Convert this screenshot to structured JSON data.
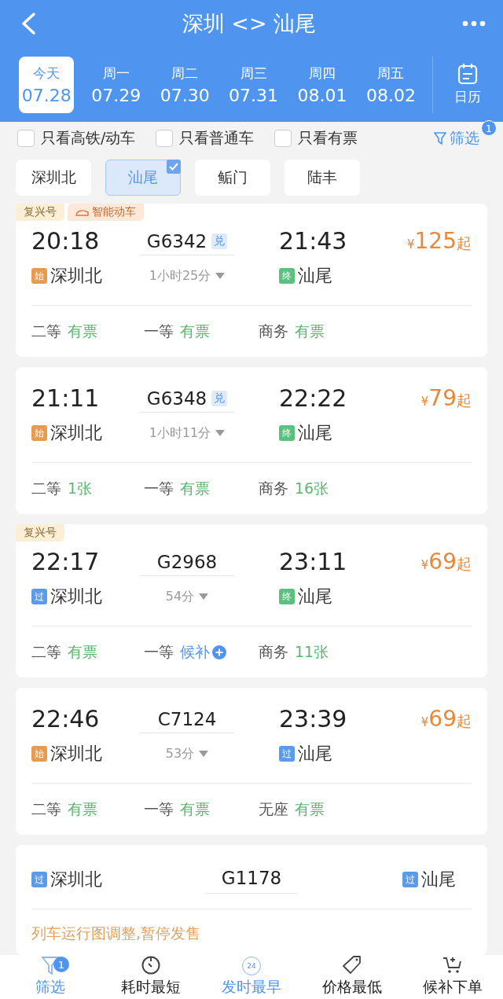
{
  "header": {
    "title": "深圳 <> 汕尾"
  },
  "dates": [
    {
      "weekday": "今天",
      "date": "07.28",
      "selected": true
    },
    {
      "weekday": "周一",
      "date": "07.29",
      "selected": false
    },
    {
      "weekday": "周二",
      "date": "07.30",
      "selected": false
    },
    {
      "weekday": "周三",
      "date": "07.31",
      "selected": false
    },
    {
      "weekday": "周四",
      "date": "08.01",
      "selected": false
    },
    {
      "weekday": "周五",
      "date": "08.02",
      "selected": false
    }
  ],
  "calendar": {
    "label": "日历"
  },
  "filters": [
    {
      "label": "只看高铁/动车",
      "checked": false
    },
    {
      "label": "只看普通车",
      "checked": false
    },
    {
      "label": "只看有票",
      "checked": false
    }
  ],
  "filter_button": {
    "label": "筛选",
    "badge": "1"
  },
  "stations": [
    {
      "label": "深圳北",
      "selected": false
    },
    {
      "label": "汕尾",
      "selected": true
    },
    {
      "label": "鲘门",
      "selected": false
    },
    {
      "label": "陆丰",
      "selected": false
    }
  ],
  "trains": [
    {
      "kind": "normal",
      "tags": [
        {
          "kind": "fuxing",
          "label": "复兴号"
        },
        {
          "kind": "smart",
          "label": "智能动车"
        }
      ],
      "depart_time": "20:18",
      "train_no": "G6342",
      "exchange": "兑",
      "duration": "1小时25分",
      "arrive_time": "21:43",
      "currency": "¥",
      "price": "125",
      "price_suffix": "起",
      "from": {
        "kind": "start",
        "badge": "始",
        "name": "深圳北"
      },
      "to": {
        "kind": "end",
        "badge": "终",
        "name": "汕尾"
      },
      "seats": [
        {
          "class": "二等",
          "status": "有票",
          "kind": "available"
        },
        {
          "class": "一等",
          "status": "有票",
          "kind": "available"
        },
        {
          "class": "商务",
          "status": "有票",
          "kind": "available"
        }
      ]
    },
    {
      "kind": "normal",
      "depart_time": "21:11",
      "train_no": "G6348",
      "exchange": "兑",
      "duration": "1小时11分",
      "arrive_time": "22:22",
      "currency": "¥",
      "price": "79",
      "price_suffix": "起",
      "from": {
        "kind": "start",
        "badge": "始",
        "name": "深圳北"
      },
      "to": {
        "kind": "end",
        "badge": "终",
        "name": "汕尾"
      },
      "seats": [
        {
          "class": "二等",
          "status": "1张",
          "kind": "available"
        },
        {
          "class": "一等",
          "status": "有票",
          "kind": "available"
        },
        {
          "class": "商务",
          "status": "16张",
          "kind": "available"
        }
      ]
    },
    {
      "kind": "normal",
      "tags": [
        {
          "kind": "fuxing",
          "label": "复兴号"
        }
      ],
      "depart_time": "22:17",
      "train_no": "G2968",
      "duration": "54分",
      "arrive_time": "23:11",
      "currency": "¥",
      "price": "69",
      "price_suffix": "起",
      "from": {
        "kind": "pass",
        "badge": "过",
        "name": "深圳北"
      },
      "to": {
        "kind": "end",
        "badge": "终",
        "name": "汕尾"
      },
      "seats": [
        {
          "class": "二等",
          "status": "有票",
          "kind": "available"
        },
        {
          "class": "一等",
          "status": "候补",
          "kind": "waitlist"
        },
        {
          "class": "商务",
          "status": "11张",
          "kind": "available"
        }
      ]
    },
    {
      "kind": "normal",
      "depart_time": "22:46",
      "train_no": "C7124",
      "duration": "53分",
      "arrive_time": "23:39",
      "currency": "¥",
      "price": "69",
      "price_suffix": "起",
      "from": {
        "kind": "start",
        "badge": "始",
        "name": "深圳北"
      },
      "to": {
        "kind": "pass",
        "badge": "过",
        "name": "汕尾"
      },
      "seats": [
        {
          "class": "二等",
          "status": "有票",
          "kind": "available"
        },
        {
          "class": "一等",
          "status": "有票",
          "kind": "available"
        },
        {
          "class": "无座",
          "status": "有票",
          "kind": "available"
        }
      ]
    },
    {
      "kind": "suspended",
      "train_no": "G1178",
      "from": {
        "kind": "pass",
        "badge": "过",
        "name": "深圳北"
      },
      "to": {
        "kind": "pass",
        "badge": "过",
        "name": "汕尾"
      },
      "notice": "列车运行图调整,暂停发售"
    }
  ],
  "bottom_nav": [
    {
      "label": "筛选",
      "selected": true,
      "badge": "1"
    },
    {
      "label": "耗时最短",
      "selected": false
    },
    {
      "icon_text": "24",
      "label": "发时最早",
      "selected": true
    },
    {
      "label": "价格最低",
      "selected": false
    },
    {
      "label": "候补下单",
      "selected": false
    }
  ]
}
